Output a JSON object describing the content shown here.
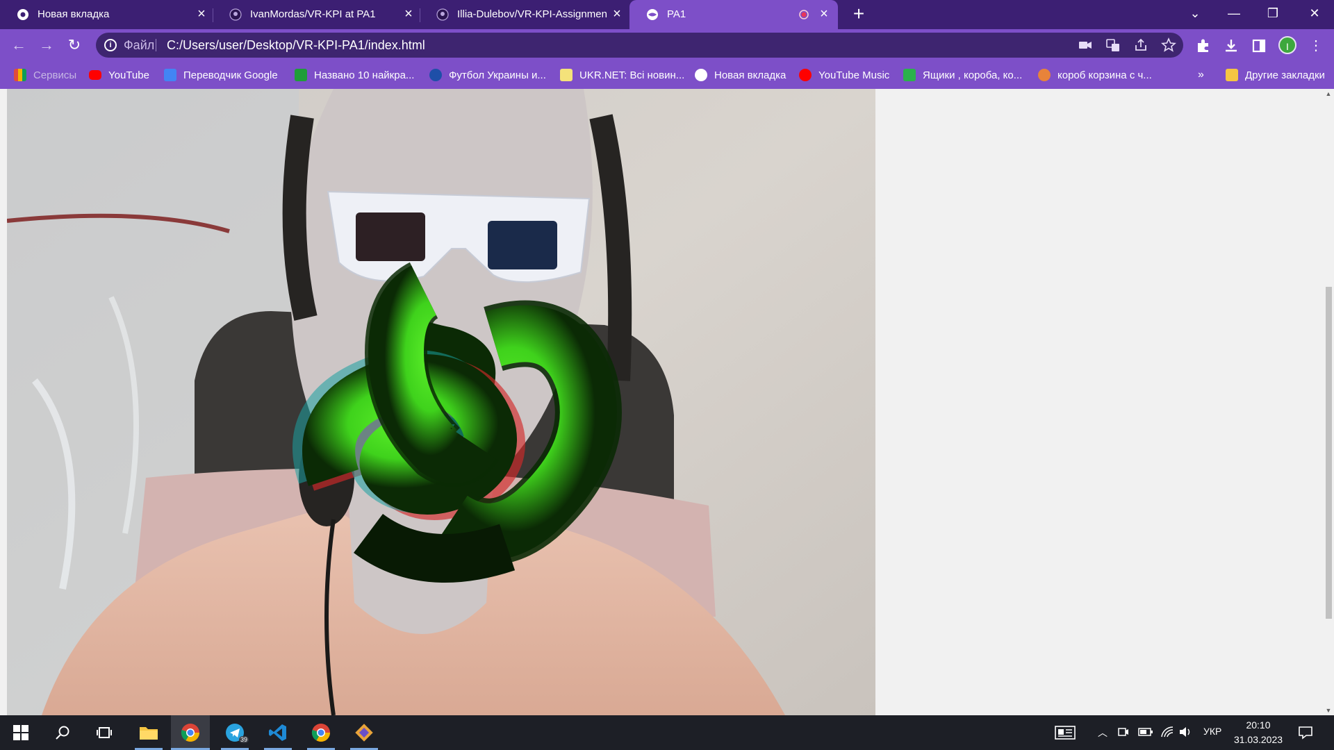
{
  "browser": {
    "tabs": [
      {
        "title": "Новая вкладка",
        "favicon": "chrome-icon"
      },
      {
        "title": "IvanMordas/VR-KPI at PA1",
        "favicon": "github-icon"
      },
      {
        "title": "Illia-Dulebov/VR-KPI-Assignment",
        "favicon": "github-icon"
      },
      {
        "title": "PA1",
        "favicon": "globe-icon",
        "active": true,
        "recording": true
      }
    ],
    "new_tab_label": "+",
    "window_controls": {
      "minimize": "—",
      "restore": "❐",
      "close": "✕",
      "tab_search": "⌄"
    }
  },
  "toolbar": {
    "back": "←",
    "forward": "→",
    "reload": "↻",
    "scheme_label": "Файл",
    "url": "C:/Users/user/Desktop/VR-KPI-PA1/index.html"
  },
  "bookmarks": {
    "items": [
      {
        "label": "Сервисы",
        "icon": "apps-grid-icon",
        "color": "#e04b3b",
        "dim": true
      },
      {
        "label": "YouTube",
        "icon": "youtube-icon",
        "color": "#ff0000"
      },
      {
        "label": "Переводчик Google",
        "icon": "google-translate-icon",
        "color": "#4285f4"
      },
      {
        "label": "Названо 10 найкра...",
        "icon": "e-icon",
        "color": "#1f9d3a"
      },
      {
        "label": "Футбол Украины и...",
        "icon": "football-icon",
        "color": "#1e4fa8"
      },
      {
        "label": "UKR.NET: Всі новин...",
        "icon": "ukrnet-icon",
        "color": "#f4c430"
      },
      {
        "label": "Новая вкладка",
        "icon": "globe-icon",
        "color": "#ffffff"
      },
      {
        "label": "YouTube Music",
        "icon": "youtube-music-icon",
        "color": "#ff0000"
      },
      {
        "label": "Ящики , короба, ко...",
        "icon": "box-store-icon",
        "color": "#2bb24c"
      },
      {
        "label": "короб корзина с ч...",
        "icon": "basket-store-icon",
        "color": "#e8833a"
      }
    ],
    "overflow": "»",
    "other_label": "Другие закладки"
  },
  "content": {
    "scene": "webcam video with green 3D anaglyph knot surface"
  },
  "taskbar": {
    "apps": [
      {
        "name": "start-button"
      },
      {
        "name": "search-button"
      },
      {
        "name": "task-view-button"
      },
      {
        "name": "file-explorer"
      },
      {
        "name": "chrome",
        "active": true
      },
      {
        "name": "telegram",
        "badge": "39"
      },
      {
        "name": "vscode"
      },
      {
        "name": "chrome-profile-2"
      },
      {
        "name": "git-client"
      }
    ],
    "lang": "УКР",
    "time": "20:10",
    "date": "31.03.2023"
  },
  "colors": {
    "tabstrip": "#3c1f73",
    "toolbar": "#7d4fc8",
    "omnibox": "#3e2570",
    "knot": "#3fd21c"
  }
}
